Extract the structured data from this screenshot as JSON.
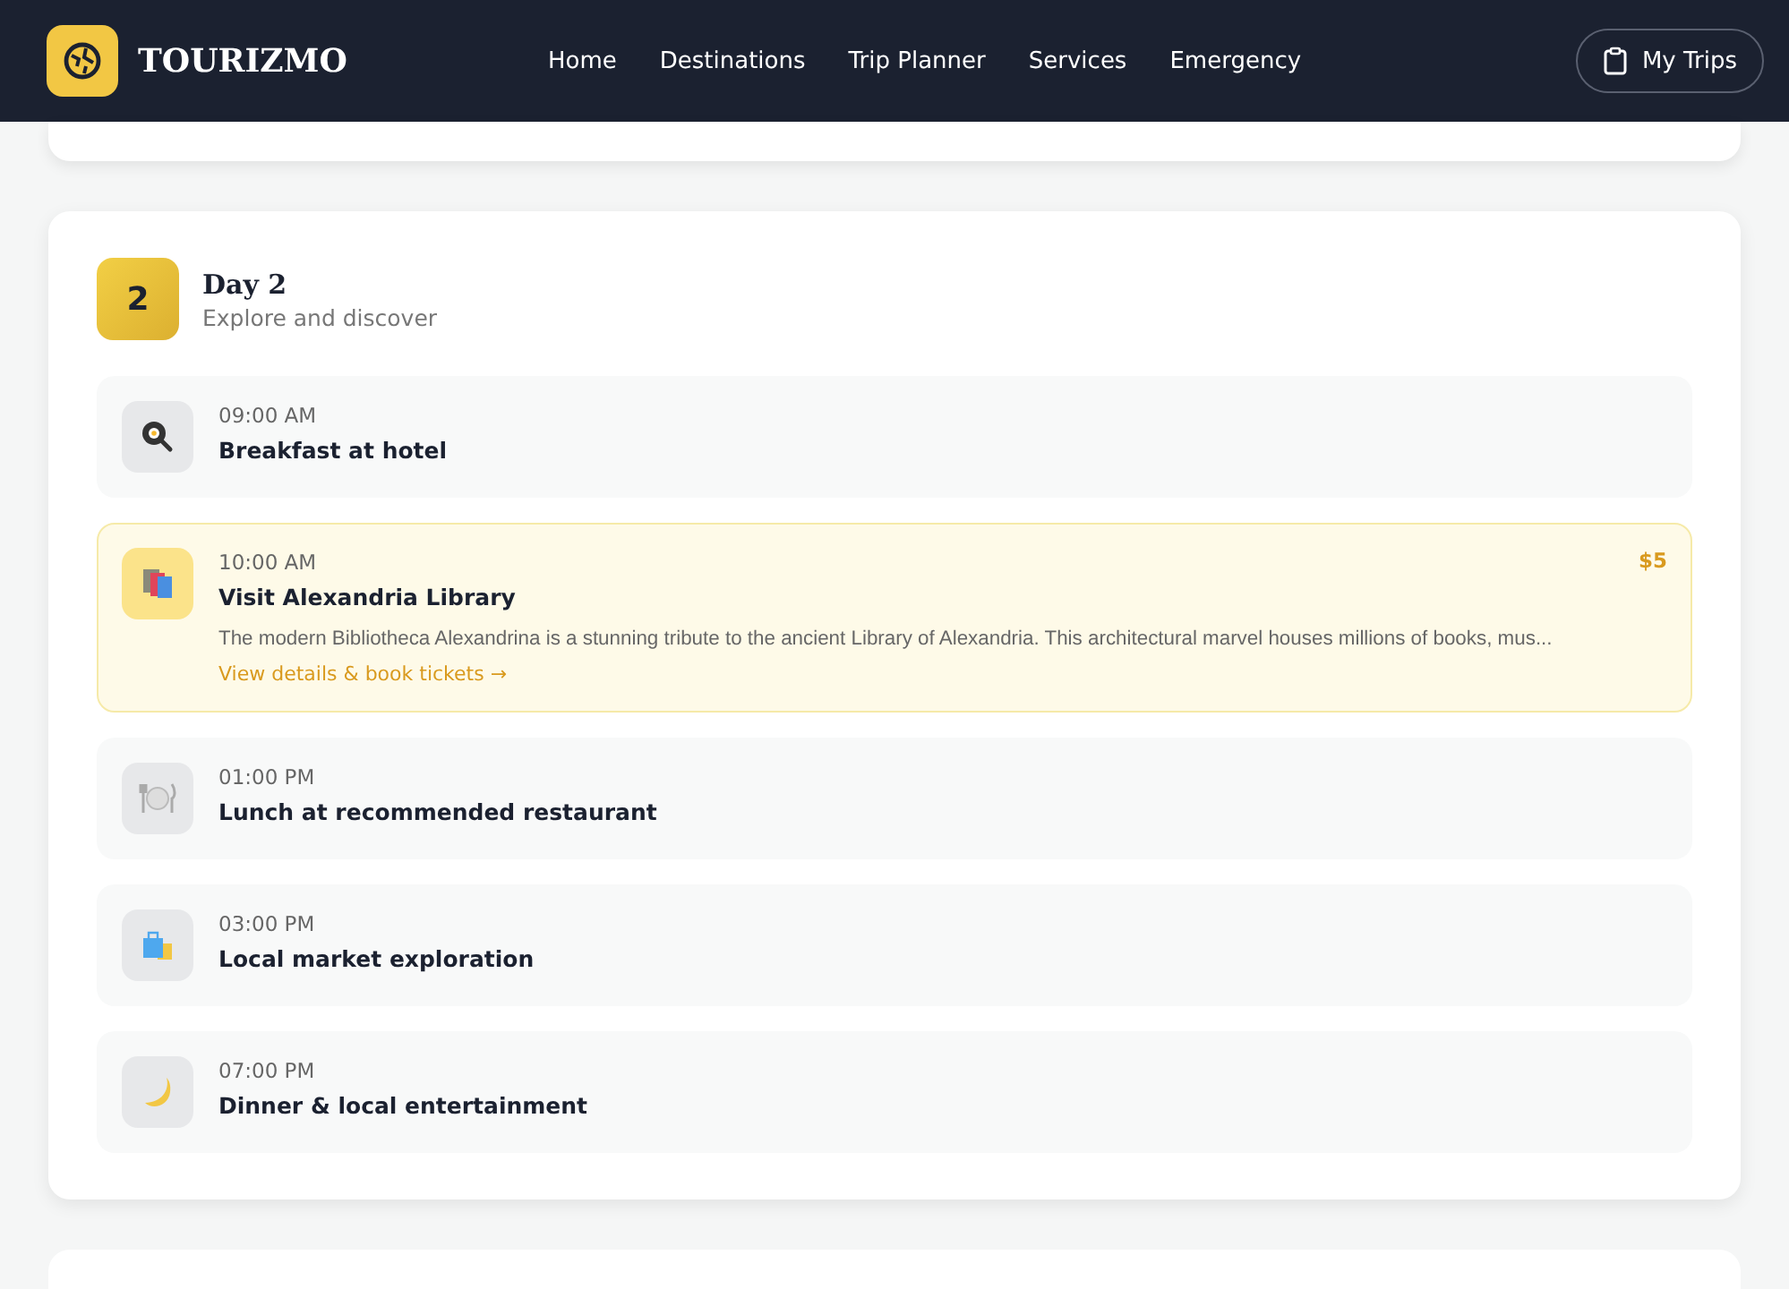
{
  "navbar": {
    "brand": "TOURIZMO",
    "links": [
      "Home",
      "Destinations",
      "Trip Planner",
      "Services",
      "Emergency"
    ],
    "action": "My Trips"
  },
  "day": {
    "number": "2",
    "title": "Day 2",
    "subtitle": "Explore and discover",
    "activities": [
      {
        "kind": "breakfast",
        "time": "09:00 AM",
        "title": "Breakfast at hotel",
        "featured": false
      },
      {
        "kind": "sightseeing",
        "time": "10:00 AM",
        "title": "Visit Alexandria Library",
        "featured": true,
        "price": "$5",
        "description": "The modern Bibliotheca Alexandrina is a stunning tribute to the ancient Library of Alexandria. This architectural marvel houses millions of books, mus...",
        "link": "View details & book tickets →"
      },
      {
        "kind": "lunch",
        "time": "01:00 PM",
        "title": "Lunch at recommended restaurant",
        "featured": false
      },
      {
        "kind": "shopping",
        "time": "03:00 PM",
        "title": "Local market exploration",
        "featured": false
      },
      {
        "kind": "dinner",
        "time": "07:00 PM",
        "title": "Dinner & local entertainment",
        "featured": false
      }
    ]
  }
}
